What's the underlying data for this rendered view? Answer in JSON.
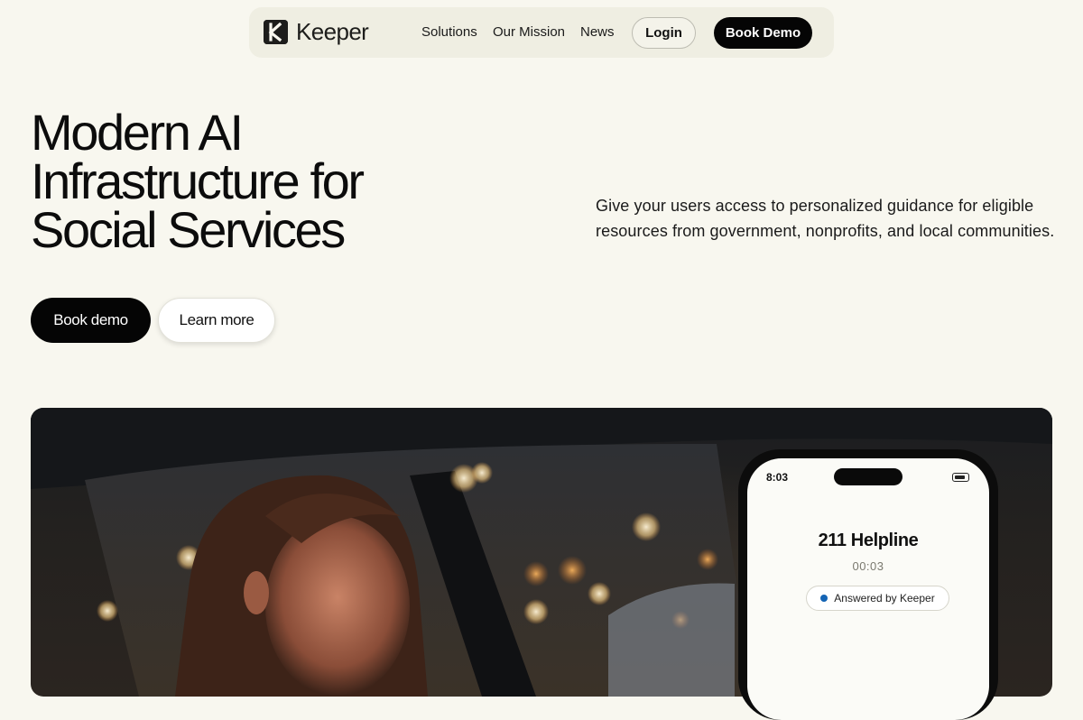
{
  "brand": {
    "name": "Keeper"
  },
  "nav": {
    "links": [
      "Solutions",
      "Our Mission",
      "News"
    ],
    "login_label": "Login",
    "demo_label": "Book Demo"
  },
  "hero": {
    "title_lines": [
      "Modern AI",
      "Infrastructure for",
      "Social Services"
    ],
    "subtitle": "Give your users access to personalized guidance for eligible resources from government, nonprofits, and local communities.",
    "primary_cta": "Book demo",
    "secondary_cta": "Learn more"
  },
  "phone": {
    "time": "8:03",
    "call_title": "211 Helpline",
    "call_timer": "00:03",
    "status_badge": "Answered by Keeper",
    "status_color": "#1464b4"
  },
  "colors": {
    "page_bg": "#f8f7ef",
    "nav_bg": "#efeee2",
    "primary": "#050505"
  }
}
